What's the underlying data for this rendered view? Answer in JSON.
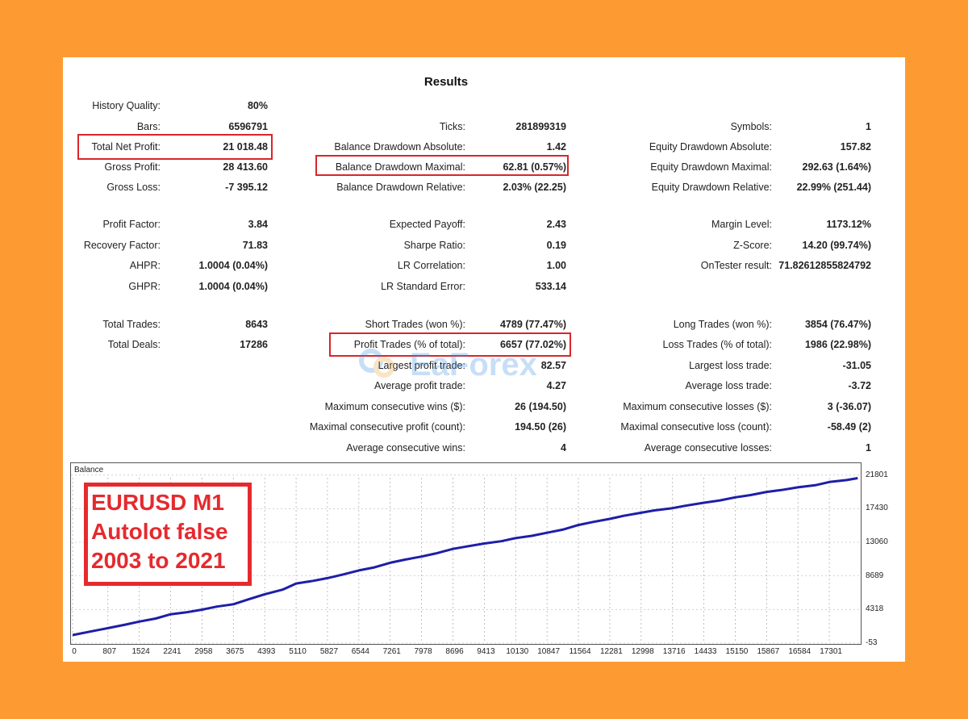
{
  "title": "Results",
  "colors": {
    "background": "#fd9b32",
    "highlight": "#d8262b",
    "line": "#1e1ea8",
    "watermark": "#3b8ee0"
  },
  "watermark": "EaForex",
  "rows": [
    {
      "c1": {
        "label": "History Quality:",
        "value": "80%"
      }
    },
    {
      "c1": {
        "label": "Bars:",
        "value": "6596791"
      },
      "c2": {
        "label": "Ticks:",
        "value": "281899319"
      },
      "c3": {
        "label": "Symbols:",
        "value": "1"
      }
    },
    {
      "c1": {
        "label": "Total Net Profit:",
        "value": "21 018.48"
      },
      "c2": {
        "label": "Balance Drawdown Absolute:",
        "value": "1.42"
      },
      "c3": {
        "label": "Equity Drawdown Absolute:",
        "value": "157.82"
      }
    },
    {
      "c1": {
        "label": "Gross Profit:",
        "value": "28 413.60"
      },
      "c2": {
        "label": "Balance Drawdown Maximal:",
        "value": "62.81 (0.57%)"
      },
      "c3": {
        "label": "Equity Drawdown Maximal:",
        "value": "292.63 (1.64%)"
      }
    },
    {
      "c1": {
        "label": "Gross Loss:",
        "value": "-7 395.12"
      },
      "c2": {
        "label": "Balance Drawdown Relative:",
        "value": "2.03% (22.25)"
      },
      "c3": {
        "label": "Equity Drawdown Relative:",
        "value": "22.99% (251.44)"
      }
    },
    {
      "c1": {
        "label": "Profit Factor:",
        "value": "3.84"
      },
      "c2": {
        "label": "Expected Payoff:",
        "value": "2.43"
      },
      "c3": {
        "label": "Margin Level:",
        "value": "1173.12%"
      }
    },
    {
      "c1": {
        "label": "Recovery Factor:",
        "value": "71.83"
      },
      "c2": {
        "label": "Sharpe Ratio:",
        "value": "0.19"
      },
      "c3": {
        "label": "Z-Score:",
        "value": "14.20 (99.74%)"
      }
    },
    {
      "c1": {
        "label": "AHPR:",
        "value": "1.0004 (0.04%)"
      },
      "c2": {
        "label": "LR Correlation:",
        "value": "1.00"
      },
      "c3": {
        "label": "OnTester result:",
        "value": "71.82612855824792"
      }
    },
    {
      "c1": {
        "label": "GHPR:",
        "value": "1.0004 (0.04%)"
      },
      "c2": {
        "label": "LR Standard Error:",
        "value": "533.14"
      }
    },
    {
      "c1": {
        "label": "Total Trades:",
        "value": "8643"
      },
      "c2": {
        "label": "Short Trades (won %):",
        "value": "4789 (77.47%)"
      },
      "c3": {
        "label": "Long Trades (won %):",
        "value": "3854 (76.47%)"
      }
    },
    {
      "c1": {
        "label": "Total Deals:",
        "value": "17286"
      },
      "c2": {
        "label": "Profit Trades (% of total):",
        "value": "6657 (77.02%)"
      },
      "c3": {
        "label": "Loss Trades (% of total):",
        "value": "1986 (22.98%)"
      }
    },
    {
      "c2": {
        "label": "Largest profit trade:",
        "value": "82.57"
      },
      "c3": {
        "label": "Largest loss trade:",
        "value": "-31.05"
      }
    },
    {
      "c2": {
        "label": "Average profit trade:",
        "value": "4.27"
      },
      "c3": {
        "label": "Average loss trade:",
        "value": "-3.72"
      }
    },
    {
      "c2": {
        "label": "Maximum consecutive wins ($):",
        "value": "26 (194.50)"
      },
      "c3": {
        "label": "Maximum consecutive losses ($):",
        "value": "3 (-36.07)"
      }
    },
    {
      "c2": {
        "label": "Maximal consecutive profit (count):",
        "value": "194.50 (26)"
      },
      "c3": {
        "label": "Maximal consecutive loss (count):",
        "value": "-58.49 (2)"
      }
    },
    {
      "c2": {
        "label": "Average consecutive wins:",
        "value": "4"
      },
      "c3": {
        "label": "Average consecutive losses:",
        "value": "1"
      }
    }
  ],
  "overlay": {
    "line1": "EURUSD M1",
    "line2": "Autolot false",
    "line3": "2003 to 2021"
  },
  "chart_data": {
    "type": "line",
    "title": "Balance",
    "ylim": [
      -53,
      22500
    ],
    "xlim": [
      0,
      18000
    ],
    "y_ticks": [
      "21801",
      "17430",
      "13060",
      "8689",
      "4318",
      "-53"
    ],
    "y_tick_values": [
      21801,
      17430,
      13060,
      8689,
      4318,
      -53
    ],
    "x_ticks": [
      "0",
      "807",
      "1524",
      "2241",
      "2958",
      "3675",
      "4393",
      "5110",
      "5827",
      "6544",
      "7261",
      "7978",
      "8696",
      "9413",
      "10130",
      "10847",
      "11564",
      "12281",
      "12998",
      "13716",
      "14433",
      "15150",
      "15867",
      "16584",
      "17301"
    ],
    "x_tick_values": [
      0,
      807,
      1524,
      2241,
      2958,
      3675,
      4393,
      5110,
      5827,
      6544,
      7261,
      7978,
      8696,
      9413,
      10130,
      10847,
      11564,
      12281,
      12998,
      13716,
      14433,
      15150,
      15867,
      16584,
      17301
    ],
    "series": [
      {
        "x": [
          0,
          400,
          807,
          1200,
          1524,
          1900,
          2241,
          2600,
          2958,
          3300,
          3675,
          4000,
          4393,
          4800,
          5110,
          5500,
          5827,
          6200,
          6544,
          6900,
          7261,
          7600,
          7978,
          8300,
          8696,
          9000,
          9413,
          9800,
          10130,
          10500,
          10847,
          11200,
          11564,
          11900,
          12281,
          12600,
          12998,
          13300,
          13716,
          14000,
          14433,
          14800,
          15150,
          15500,
          15867,
          16200,
          16584,
          17000,
          17301,
          17700,
          17950
        ],
        "values": [
          1000,
          1450,
          1900,
          2350,
          2750,
          3150,
          3700,
          3950,
          4300,
          4700,
          5000,
          5600,
          6300,
          6900,
          7700,
          8050,
          8400,
          8900,
          9400,
          9800,
          10400,
          10800,
          11200,
          11600,
          12200,
          12500,
          12900,
          13200,
          13600,
          13900,
          14300,
          14700,
          15300,
          15700,
          16100,
          16500,
          16900,
          17200,
          17500,
          17800,
          18200,
          18500,
          18900,
          19200,
          19600,
          19850,
          20200,
          20500,
          20900,
          21150,
          21400
        ]
      }
    ]
  }
}
